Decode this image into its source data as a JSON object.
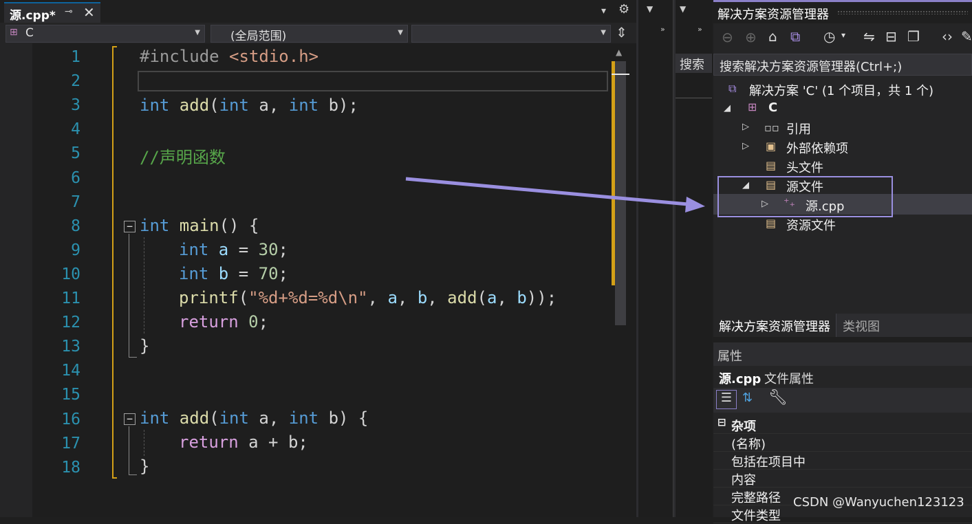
{
  "editor": {
    "tab_title": "源.cpp*",
    "tab_pin": "⊸",
    "tab_close": "✕",
    "nav_project": "C",
    "nav_scope": "(全局范围)",
    "nav_member": "",
    "line_numbers": [
      "1",
      "2",
      "3",
      "4",
      "5",
      "6",
      "7",
      "8",
      "9",
      "10",
      "11",
      "12",
      "13",
      "14",
      "15",
      "16",
      "17",
      "18"
    ],
    "lines": {
      "l1_a": "#include ",
      "l1_b": "<stdio.h>",
      "l3_a": "int",
      "l3_b": " add",
      "l3_c": "(",
      "l3_d": "int",
      "l3_e": " a, ",
      "l3_f": "int",
      "l3_g": " b);",
      "l5": "//声明函数",
      "l8_a": "int",
      "l8_b": " main",
      "l8_c": "() {",
      "l9_a": "int",
      "l9_b": " a",
      "l9_c": " = ",
      "l9_d": "30",
      "l9_e": ";",
      "l10_a": "int",
      "l10_b": " b",
      "l10_c": " = ",
      "l10_d": "70",
      "l10_e": ";",
      "l11_a": "printf",
      "l11_b": "(",
      "l11_c": "\"%d+%d=%d\\n\"",
      "l11_d": ", ",
      "l11_e": "a",
      "l11_f": ", ",
      "l11_g": "b",
      "l11_h": ", ",
      "l11_i": "add",
      "l11_j": "(",
      "l11_k": "a",
      "l11_l": ", ",
      "l11_m": "b",
      "l11_n": "));",
      "l12_a": "return",
      "l12_b": " ",
      "l12_c": "0",
      "l12_d": ";",
      "l13": "}",
      "l16_a": "int",
      "l16_b": " add",
      "l16_c": "(",
      "l16_d": "int",
      "l16_e": " a, ",
      "l16_f": "int",
      "l16_g": " b) {",
      "l17_a": "return",
      "l17_b": " a + b;",
      "l18": "}"
    }
  },
  "middle": {
    "search_label": "搜索"
  },
  "solution_explorer": {
    "title": "解决方案资源管理器",
    "search_placeholder": "搜索解决方案资源管理器(Ctrl+;)",
    "solution": "解决方案 'C' (1 个项目，共 1 个)",
    "project": "C",
    "items": {
      "references": "引用",
      "external_deps": "外部依赖项",
      "header_files": "头文件",
      "source_files": "源文件",
      "source_cpp": "源.cpp",
      "resource_files": "资源文件"
    },
    "tabs": [
      "解决方案资源管理器",
      "类视图"
    ]
  },
  "properties": {
    "title": "属性",
    "subject": "源.cpp",
    "subject_kind": "文件属性",
    "category": "杂项",
    "rows": [
      "(名称)",
      "包括在项目中",
      "内容",
      "完整路径",
      "文件类型"
    ]
  },
  "watermark": "CSDN @Wanyuchen123123",
  "colors": {
    "keyword": "#569cd6",
    "string": "#d69d85",
    "comment": "#57a64a",
    "line_number": "#2b91af",
    "highlight_box": "#9a8fe0",
    "change_bar": "#d4a017"
  }
}
